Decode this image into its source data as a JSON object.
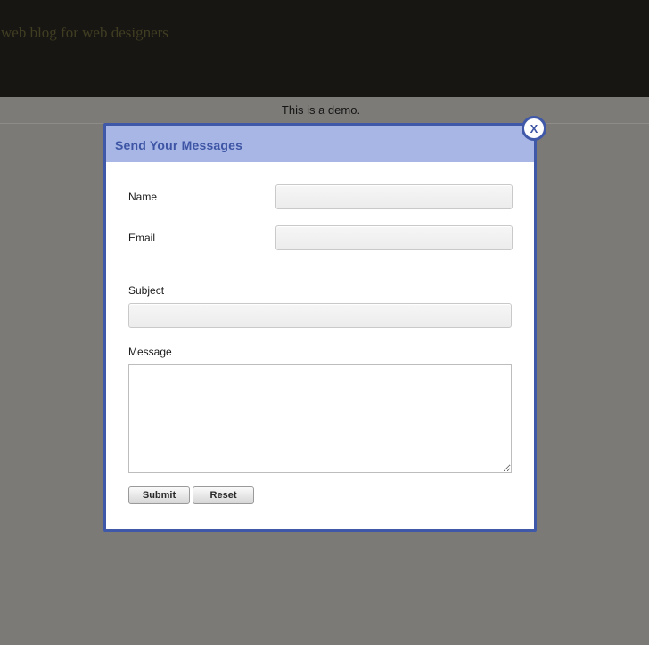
{
  "header": {
    "tagline": "web blog for web designers"
  },
  "demo_bar": {
    "text": "This is a demo."
  },
  "modal": {
    "title": "Send Your Messages",
    "close_label": "X",
    "fields": {
      "name_label": "Name",
      "name_value": "",
      "email_label": "Email",
      "email_value": "",
      "subject_label": "Subject",
      "subject_value": "",
      "message_label": "Message",
      "message_value": ""
    },
    "buttons": {
      "submit_label": "Submit",
      "reset_label": "Reset"
    }
  },
  "colors": {
    "header_bg": "#181612",
    "overlay_bg": "#7b7a77",
    "modal_border": "#3f58a8",
    "modal_header_bg": "#a8b6e6",
    "modal_title": "#3d55a4"
  }
}
